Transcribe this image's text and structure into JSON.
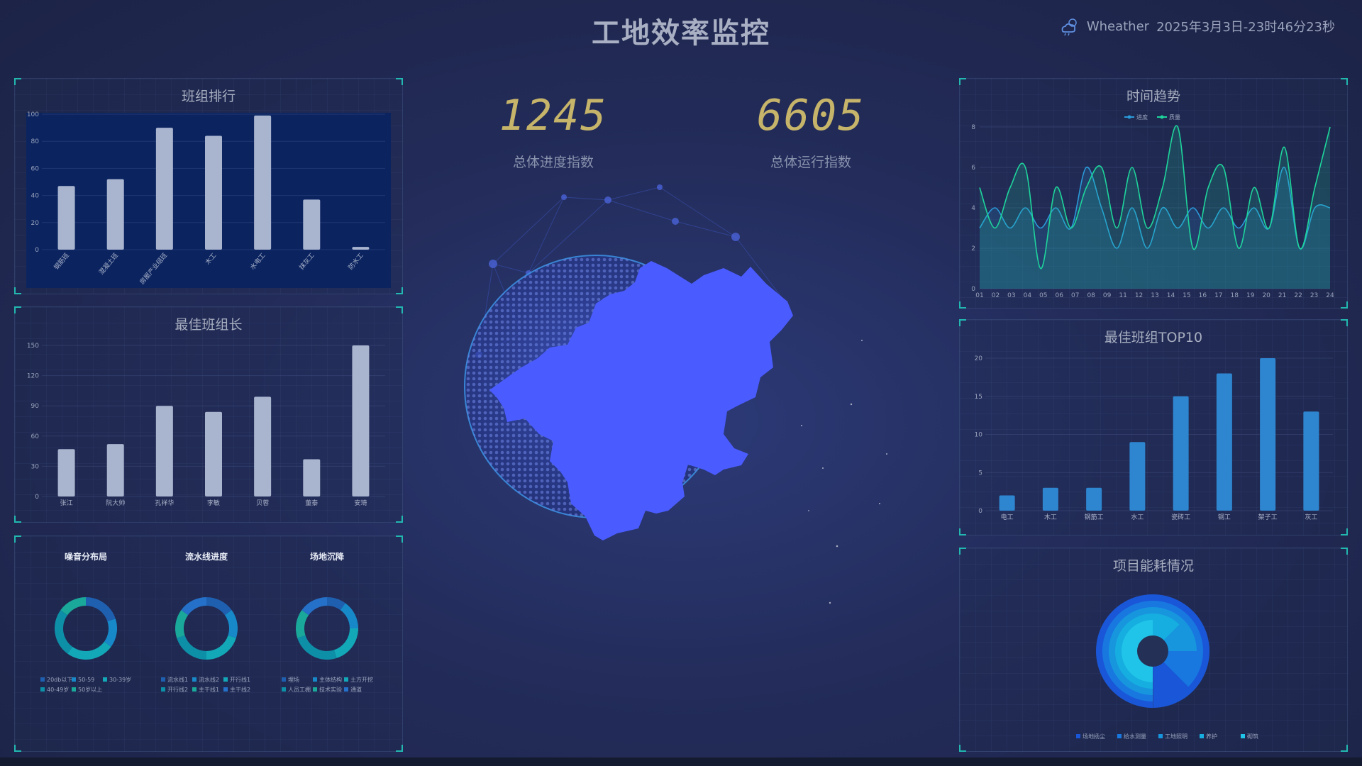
{
  "header": {
    "title": "工地效率监控",
    "weather_label": "Wheather",
    "datetime": "2025年3月3日-23时46分23秒"
  },
  "kpis": [
    {
      "value": "1245",
      "label": "总体进度指数"
    },
    {
      "value": "6605",
      "label": "总体运行指数"
    }
  ],
  "panels": {
    "team_ranking": {
      "title": "班组排行"
    },
    "best_leader": {
      "title": "最佳班组长"
    },
    "donuts": {
      "titles": [
        "噪音分布局",
        "流水线进度",
        "场地沉降"
      ]
    },
    "time_trend": {
      "title": "时间趋势"
    },
    "top10": {
      "title": "最佳班组TOP10"
    },
    "energy": {
      "title": "项目能耗情况"
    }
  },
  "colors": {
    "accent": "#22b8b0",
    "map_fill": "#4a5cff",
    "bar_light": "#a9b4cf",
    "bar_blue": "#2e86d0",
    "line_green": "#1ed59c",
    "line_blue": "#2a9ad8"
  },
  "chart_data": [
    {
      "id": "team_ranking",
      "type": "bar",
      "categories": [
        "钢筋班",
        "混凝土班",
        "房屋产业组班",
        "木工",
        "水电工",
        "抹灰工",
        "防水工"
      ],
      "values": [
        47,
        52,
        90,
        84,
        99,
        37,
        2
      ],
      "ylim": [
        0,
        100
      ],
      "yticks": [
        0,
        20,
        40,
        60,
        80,
        100
      ]
    },
    {
      "id": "best_leader",
      "type": "bar",
      "categories": [
        "张江",
        "阮大帅",
        "孔祥华",
        "李敏",
        "贝蓉",
        "董泰",
        "安琦"
      ],
      "values": [
        47,
        52,
        90,
        84,
        99,
        37,
        150
      ],
      "ylim": [
        0,
        150
      ],
      "yticks": [
        0,
        30,
        60,
        90,
        120,
        150
      ]
    },
    {
      "id": "donut_noise",
      "type": "pie",
      "legend": [
        "20db以下",
        "50-59",
        "30-39岁",
        "40-49岁",
        "50岁以上"
      ],
      "values": [
        20,
        15,
        25,
        25,
        15
      ]
    },
    {
      "id": "donut_pipeline",
      "type": "pie",
      "legend": [
        "流水线1",
        "流水线2",
        "开行线1",
        "开行线2",
        "主干线1",
        "主干线2"
      ],
      "values": [
        15,
        15,
        20,
        20,
        15,
        15
      ]
    },
    {
      "id": "donut_settlement",
      "type": "pie",
      "legend": [
        "埋场",
        "主体结构",
        "土方开挖",
        "人员工棚",
        "技术实验",
        "通道"
      ],
      "values": [
        10,
        15,
        20,
        25,
        15,
        15
      ]
    },
    {
      "id": "time_trend",
      "type": "area",
      "x": [
        "01",
        "02",
        "03",
        "04",
        "05",
        "06",
        "07",
        "08",
        "09",
        "11",
        "12",
        "13",
        "14",
        "15",
        "16",
        "17",
        "18",
        "19",
        "20",
        "21",
        "22",
        "23",
        "24"
      ],
      "series": [
        {
          "name": "进度",
          "values": [
            3,
            4,
            3,
            4,
            3,
            4,
            3,
            6,
            4,
            2,
            4,
            2,
            4,
            3,
            4,
            3,
            4,
            3,
            4,
            3,
            6,
            2,
            4,
            4
          ]
        },
        {
          "name": "质量",
          "values": [
            5,
            3,
            5,
            6,
            1,
            5,
            3,
            5,
            6,
            3,
            6,
            3,
            5,
            8,
            2,
            5,
            6,
            2,
            5,
            3,
            7,
            2,
            5,
            8
          ]
        }
      ],
      "ylim": [
        0,
        8
      ],
      "yticks": [
        0,
        2,
        4,
        6,
        8
      ]
    },
    {
      "id": "top10",
      "type": "bar",
      "categories": [
        "电工",
        "木工",
        "钢筋工",
        "水工",
        "瓷砖工",
        "钢工",
        "架子工",
        "灰工"
      ],
      "values": [
        2,
        3,
        3,
        9,
        15,
        18,
        20,
        13
      ],
      "ylim": [
        0,
        20
      ],
      "yticks": [
        0,
        5,
        10,
        15,
        20
      ]
    },
    {
      "id": "energy",
      "type": "pie",
      "legend": [
        "场地扬尘",
        "给水测量",
        "工地照明",
        "养护",
        "砌筑"
      ],
      "values": [
        100,
        85,
        70,
        55,
        40
      ]
    }
  ]
}
